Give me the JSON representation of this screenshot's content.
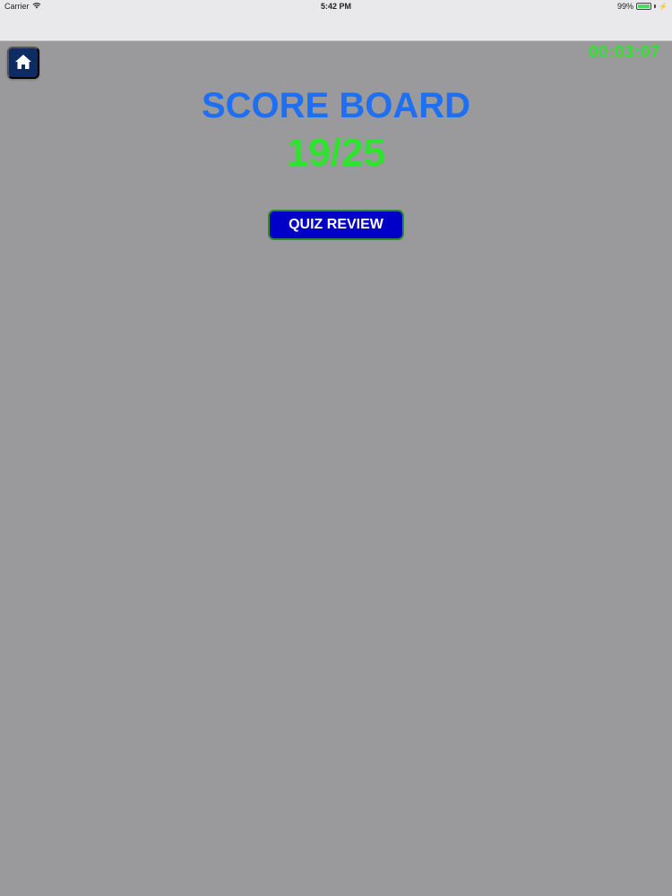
{
  "status_bar": {
    "carrier": "Carrier",
    "time": "5:42 PM",
    "battery_percent": "99%",
    "battery_level": 0.99,
    "icons": [
      "wifi-icon",
      "battery-icon",
      "charging-icon"
    ]
  },
  "header": {
    "home_icon": "home-icon",
    "timer": "00:03:07"
  },
  "main": {
    "title": "SCORE BOARD",
    "score": "19/25",
    "review_button_label": "QUIZ REVIEW"
  },
  "colors": {
    "background": "#9a999b",
    "title": "#1e6ff2",
    "score": "#2ee32e",
    "timer": "#2ee32e",
    "button_bg": "#0000c8",
    "home_bg": "#0f2b63"
  }
}
